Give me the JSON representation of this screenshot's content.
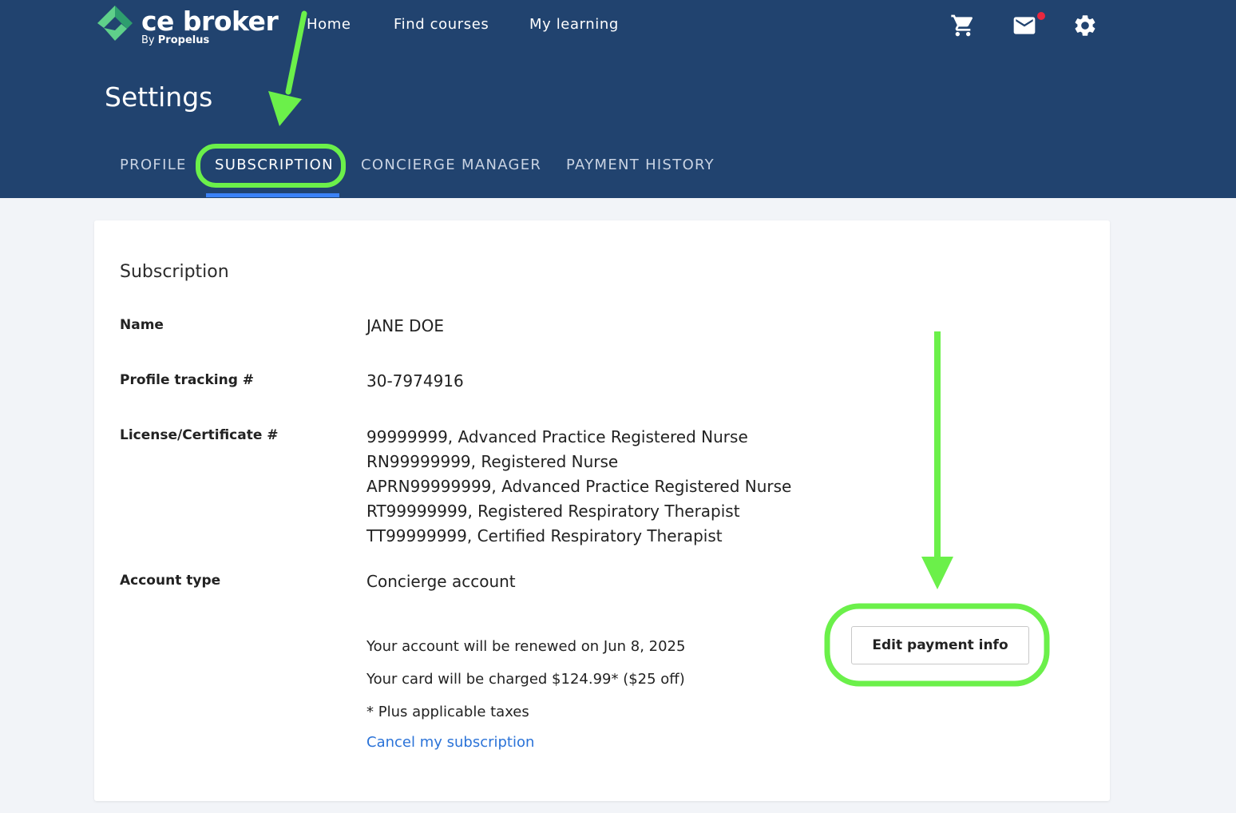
{
  "brand": {
    "name": "ce broker",
    "by_prefix": "By",
    "by_company": "Propelus"
  },
  "nav": {
    "links": [
      "Home",
      "Find courses",
      "My learning"
    ],
    "icons": [
      "cart-icon",
      "mail-icon",
      "gear-icon"
    ],
    "has_unread_mail": true
  },
  "page": {
    "title": "Settings"
  },
  "tabs": [
    {
      "label": "PROFILE",
      "active": false
    },
    {
      "label": "SUBSCRIPTION",
      "active": true
    },
    {
      "label": "CONCIERGE MANAGER",
      "active": false
    },
    {
      "label": "PAYMENT HISTORY",
      "active": false
    }
  ],
  "subscription": {
    "heading": "Subscription",
    "name_label": "Name",
    "name_value": "JANE DOE",
    "tracking_label": "Profile tracking #",
    "tracking_value": "30-7974916",
    "license_label": "License/Certificate #",
    "licenses": [
      "99999999, Advanced Practice Registered Nurse",
      "RN99999999, Registered Nurse",
      "APRN99999999, Advanced Practice Registered Nurse",
      "RT99999999, Registered Respiratory Therapist",
      "TT99999999, Certified Respiratory Therapist"
    ],
    "account_type_label": "Account type",
    "account_type_value": "Concierge account",
    "renewal_text": "Your account will be renewed on Jun 8, 2025",
    "charge_text": "Your card will be charged $124.99* ($25 off)",
    "tax_note": "* Plus applicable taxes",
    "cancel_link": "Cancel my subscription",
    "edit_payment_button": "Edit payment info"
  },
  "colors": {
    "header_bg": "#21436f",
    "tab_underline": "#3b82f6",
    "link": "#2b73d8",
    "notification": "#e8283f",
    "annotation": "#6bf04a",
    "logo_green_dark": "#2e9e6e",
    "logo_green_light": "#5fd08a"
  }
}
